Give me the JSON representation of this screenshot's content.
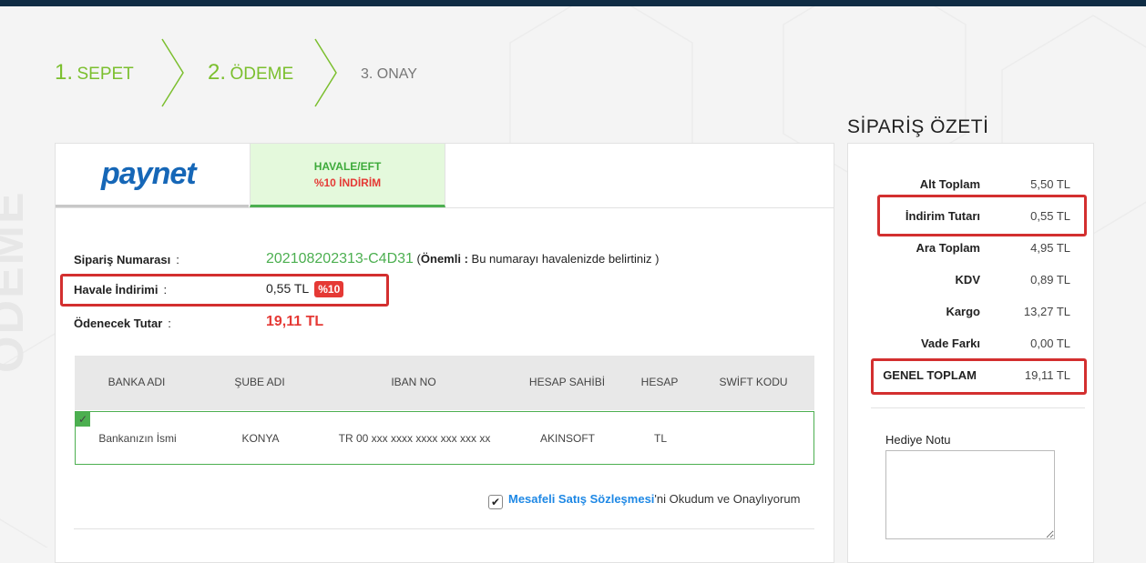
{
  "steps": [
    {
      "num": "1.",
      "label": "SEPET"
    },
    {
      "num": "2.",
      "label": "ÖDEME"
    },
    {
      "num": "3.",
      "label": "ONAY"
    }
  ],
  "watermark": "ÖDEME",
  "tabs": {
    "paynet_logo": "paynet",
    "havale_title": "HAVALE/EFT",
    "havale_discount": "%10 İNDİRİM"
  },
  "order": {
    "number_label": "Sipariş Numarası",
    "number_value": "202108202313-C4D31",
    "note_prefix": "(",
    "note_bold": "Önemli :",
    "note_text": " Bu numarayı havalenizde belirtiniz )",
    "discount_label": "Havale İndirimi",
    "discount_value": "0,55 TL",
    "discount_badge": "%10",
    "payable_label": "Ödenecek Tutar",
    "payable_value": "19,11 TL",
    "colon": ":"
  },
  "bank_table": {
    "headers": [
      "BANKA ADI",
      "ŞUBE ADI",
      "IBAN NO",
      "HESAP SAHİBİ",
      "HESAP",
      "SWİFT KODU"
    ],
    "row": [
      "Bankanızın İsmi",
      "KONYA",
      "TR 00 xxx xxxx xxxx xxx xxx xx",
      "AKINSOFT",
      "TL",
      ""
    ]
  },
  "agreement": {
    "checkmark": "✔",
    "link": "Mesafeli Satış Sözleşmesi",
    "text": "'ni Okudum ve Onaylıyorum"
  },
  "summary": {
    "title": "SİPARİŞ ÖZETİ",
    "rows": [
      {
        "label": "Alt Toplam",
        "value": "5,50 TL"
      },
      {
        "label": "İndirim Tutarı",
        "value": "0,55 TL"
      },
      {
        "label": "Ara Toplam",
        "value": "4,95 TL"
      },
      {
        "label": "KDV",
        "value": "0,89 TL"
      },
      {
        "label": "Kargo",
        "value": "13,27 TL"
      },
      {
        "label": "Vade Farkı",
        "value": "0,00 TL"
      },
      {
        "label": "GENEL TOPLAM",
        "value": "19,11 TL"
      }
    ],
    "gift_label": "Hediye Notu",
    "gift_value": ""
  },
  "colors": {
    "accent_green": "#7bbf2e",
    "highlight_red": "#d32f2f",
    "link_blue": "#1e88e5",
    "brand_blue": "#1667b7"
  }
}
